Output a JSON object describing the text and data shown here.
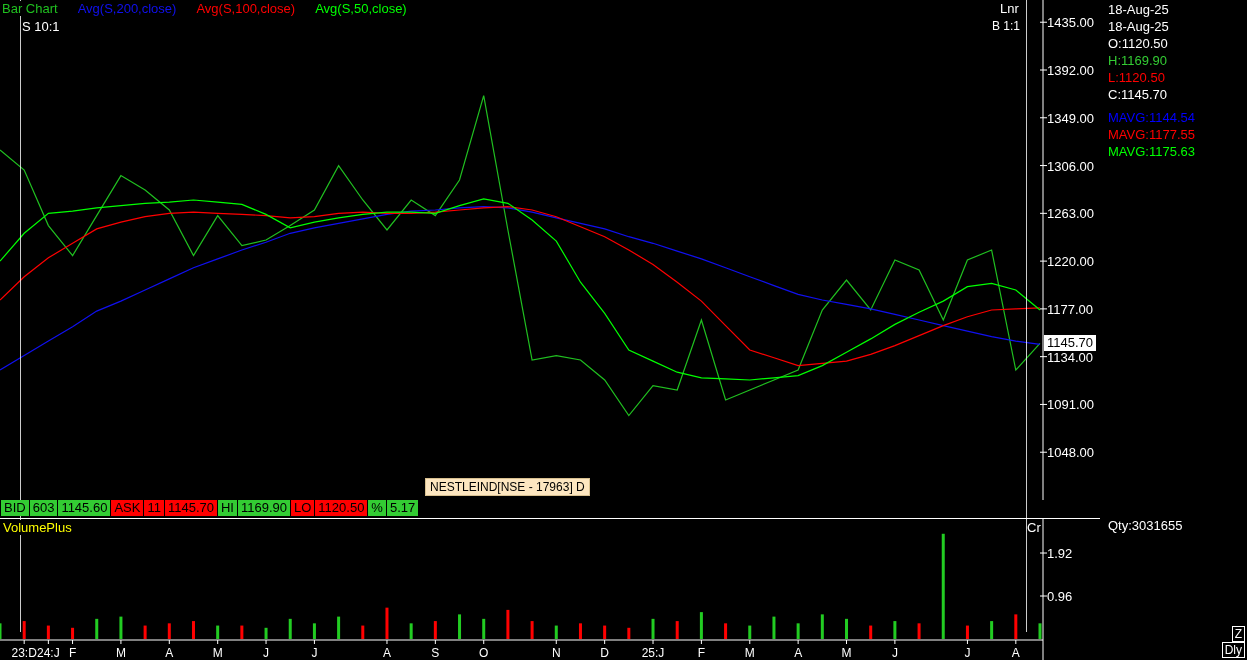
{
  "scale_label": "S 10:1",
  "scale_mode": "Lnr",
  "bar_ratio": "B 1:1",
  "price_chart": {
    "last_price": "1145.70",
    "chart_data": {
      "type": "line",
      "ylim": [
        1005,
        1455
      ],
      "yticks": [
        {
          "value": 1048,
          "label": "1048.00"
        },
        {
          "value": 1091,
          "label": "1091.00"
        },
        {
          "value": 1134,
          "label": "1134.00"
        },
        {
          "value": 1177,
          "label": "1177.00"
        },
        {
          "value": 1220,
          "label": "1220.00"
        },
        {
          "value": 1263,
          "label": "1263.00"
        },
        {
          "value": 1306,
          "label": "1306.00"
        },
        {
          "value": 1349,
          "label": "1349.00"
        },
        {
          "value": 1392,
          "label": "1392.00"
        },
        {
          "value": 1435,
          "label": "1435.00"
        }
      ],
      "series": [
        {
          "name": "Bar Chart",
          "color": "#20c020",
          "values": [
            1320,
            1302,
            1252,
            1225,
            1261,
            1297,
            1284,
            1266,
            1225,
            1261,
            1234,
            1239,
            1252,
            1266,
            1306,
            1275,
            1248,
            1275,
            1261,
            1293,
            1369,
            1248,
            1131,
            1135,
            1131,
            1113,
            1081,
            1108,
            1104,
            1167,
            1095,
            1104,
            1113,
            1122,
            1176,
            1203,
            1176,
            1221,
            1212,
            1167,
            1221,
            1230,
            1122,
            1146
          ]
        },
        {
          "name": "Avg(S,200,close)",
          "color": "#1010f0",
          "values": [
            1122,
            1135,
            1148,
            1161,
            1175,
            1184,
            1194,
            1204,
            1214,
            1222,
            1230,
            1237,
            1245,
            1250,
            1254,
            1258,
            1262,
            1265,
            1266,
            1268,
            1269,
            1268,
            1264,
            1259,
            1254,
            1249,
            1242,
            1236,
            1229,
            1222,
            1214,
            1206,
            1198,
            1190,
            1185,
            1181,
            1177,
            1172,
            1167,
            1162,
            1157,
            1152,
            1148,
            1145
          ]
        },
        {
          "name": "Avg(S,100,close)",
          "color": "#ff0000",
          "values": [
            1185,
            1206,
            1223,
            1236,
            1249,
            1255,
            1260,
            1263,
            1264,
            1263,
            1262,
            1261,
            1259,
            1260,
            1263,
            1264,
            1263,
            1263,
            1264,
            1266,
            1268,
            1269,
            1266,
            1260,
            1251,
            1242,
            1230,
            1217,
            1201,
            1184,
            1162,
            1140,
            1133,
            1126,
            1128,
            1130,
            1136,
            1144,
            1153,
            1162,
            1170,
            1176,
            1177,
            1178
          ]
        },
        {
          "name": "Avg(S,50,close)",
          "color": "#00ff00",
          "values": [
            1220,
            1245,
            1263,
            1265,
            1268,
            1270,
            1272,
            1273,
            1275,
            1273,
            1271,
            1262,
            1250,
            1255,
            1259,
            1262,
            1264,
            1264,
            1263,
            1270,
            1276,
            1272,
            1257,
            1238,
            1201,
            1173,
            1140,
            1130,
            1120,
            1115,
            1114,
            1113,
            1115,
            1117,
            1126,
            1138,
            1150,
            1163,
            1174,
            1184,
            1197,
            1200,
            1194,
            1176
          ]
        }
      ]
    }
  },
  "tooltip": "NESTLEIND[NSE - 17963] D",
  "quote_bar": [
    {
      "color": "#33cc33",
      "cells": [
        "BID",
        "603",
        "1145.60"
      ]
    },
    {
      "color": "#ff0000",
      "cells": [
        "ASK",
        "11",
        "1145.70"
      ]
    },
    {
      "color": "#33cc33",
      "cells": [
        "HI",
        "1169.90"
      ]
    },
    {
      "color": "#ff0000",
      "cells": [
        "LO",
        "1120.50"
      ]
    },
    {
      "color": "#33cc33",
      "cells": [
        "%",
        "5.17"
      ]
    }
  ],
  "volume": {
    "title": "VolumePlus",
    "unit": "Cr",
    "chart_data": {
      "type": "bar",
      "ylim": [
        0,
        2.68
      ],
      "yticks": [
        0.96,
        1.92
      ],
      "categories": [
        null,
        "23:D",
        "24:J",
        "F",
        null,
        "M",
        null,
        "A",
        null,
        "M",
        null,
        "J",
        null,
        "J",
        null,
        null,
        "A",
        null,
        "S",
        null,
        "O",
        null,
        null,
        "N",
        null,
        "D",
        null,
        "25:J",
        null,
        "F",
        null,
        "M",
        null,
        "A",
        null,
        "M",
        null,
        "J",
        null,
        null,
        "J",
        null,
        "A",
        null
      ],
      "series": [
        {
          "color": "#22cc22",
          "values": [
            0.35,
            null,
            null,
            null,
            0.45,
            0.5,
            null,
            null,
            null,
            0.3,
            null,
            0.25,
            0.45,
            0.35,
            0.5,
            null,
            null,
            0.35,
            null,
            0.55,
            0.45,
            null,
            null,
            0.3,
            null,
            null,
            null,
            0.45,
            null,
            0.6,
            null,
            0.3,
            0.5,
            0.35,
            0.55,
            0.45,
            null,
            0.4,
            null,
            2.35,
            null,
            0.4,
            null,
            0.35
          ]
        },
        {
          "color": "#ff0000",
          "values": [
            null,
            0.4,
            0.3,
            0.25,
            null,
            null,
            0.3,
            0.35,
            0.4,
            null,
            0.3,
            null,
            null,
            null,
            null,
            0.3,
            0.7,
            null,
            0.4,
            null,
            null,
            0.65,
            0.4,
            null,
            0.35,
            0.3,
            0.25,
            null,
            0.4,
            null,
            0.35,
            null,
            null,
            null,
            null,
            null,
            0.3,
            null,
            0.35,
            null,
            0.3,
            null,
            0.55,
            null
          ]
        }
      ]
    }
  },
  "details": {
    "dates": [
      "18-Aug-25",
      "18-Aug-25"
    ],
    "ohlc": [
      {
        "text": "O:1120.50",
        "color": "#ffffff"
      },
      {
        "text": "H:1169.90",
        "color": "#33cc33"
      },
      {
        "text": "L:1120.50",
        "color": "#ff0000"
      },
      {
        "text": "C:1145.70",
        "color": "#ffffff"
      }
    ],
    "mavgs": [
      {
        "text": "MAVG:1144.54",
        "color": "#0000ff"
      },
      {
        "text": "MAVG:1177.55",
        "color": "#ff0000"
      },
      {
        "text": "MAVG:1175.63",
        "color": "#00ff00"
      }
    ],
    "qty": "Qty:3031655"
  },
  "buttons": [
    {
      "label": "Z"
    },
    {
      "label": "Dly"
    }
  ]
}
